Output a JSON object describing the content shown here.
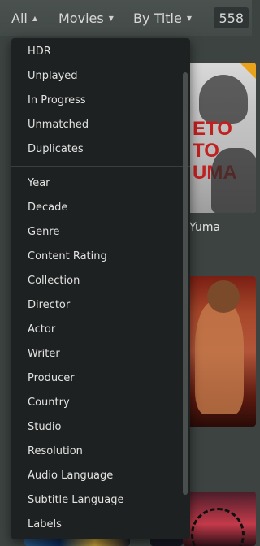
{
  "toolbar": {
    "filter_label": "All",
    "type_label": "Movies",
    "sort_label": "By Title",
    "count": "558"
  },
  "posters": {
    "caption": "Yuma",
    "poster1_text": "ETO\nTO\nUMA"
  },
  "menu": {
    "top_items": [
      {
        "label": "HDR"
      },
      {
        "label": "Unplayed"
      },
      {
        "label": "In Progress"
      },
      {
        "label": "Unmatched"
      },
      {
        "label": "Duplicates"
      }
    ],
    "bottom_items": [
      {
        "label": "Year"
      },
      {
        "label": "Decade"
      },
      {
        "label": "Genre"
      },
      {
        "label": "Content Rating"
      },
      {
        "label": "Collection"
      },
      {
        "label": "Director"
      },
      {
        "label": "Actor"
      },
      {
        "label": "Writer"
      },
      {
        "label": "Producer"
      },
      {
        "label": "Country"
      },
      {
        "label": "Studio"
      },
      {
        "label": "Resolution"
      },
      {
        "label": "Audio Language"
      },
      {
        "label": "Subtitle Language"
      },
      {
        "label": "Labels"
      }
    ]
  },
  "colors": {
    "background": "#3c4341",
    "menu_bg": "#1e2121",
    "accent_corner": "#e9a21a"
  }
}
